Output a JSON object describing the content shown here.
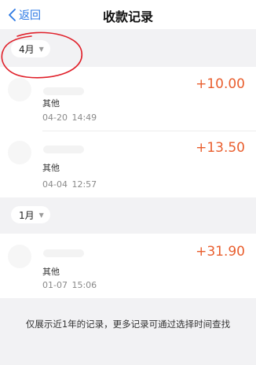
{
  "nav": {
    "back_label": "返回",
    "title": "收款记录"
  },
  "sections": [
    {
      "month_label": "4月",
      "records": [
        {
          "amount": "+10.00",
          "category": "其他",
          "date": "04-20",
          "time": "14:49"
        },
        {
          "amount": "+13.50",
          "category": "其他",
          "date": "04-04",
          "time": "12:57"
        }
      ]
    },
    {
      "month_label": "1月",
      "records": [
        {
          "amount": "+31.90",
          "category": "其他",
          "date": "01-07",
          "time": "15:06"
        }
      ]
    }
  ],
  "footer_note": "仅展示近1年的记录，更多记录可通过选择时间查找",
  "colors": {
    "accent_blue": "#2b78e4",
    "amount_orange": "#e95e2e",
    "annotation_red": "#e0202a"
  }
}
